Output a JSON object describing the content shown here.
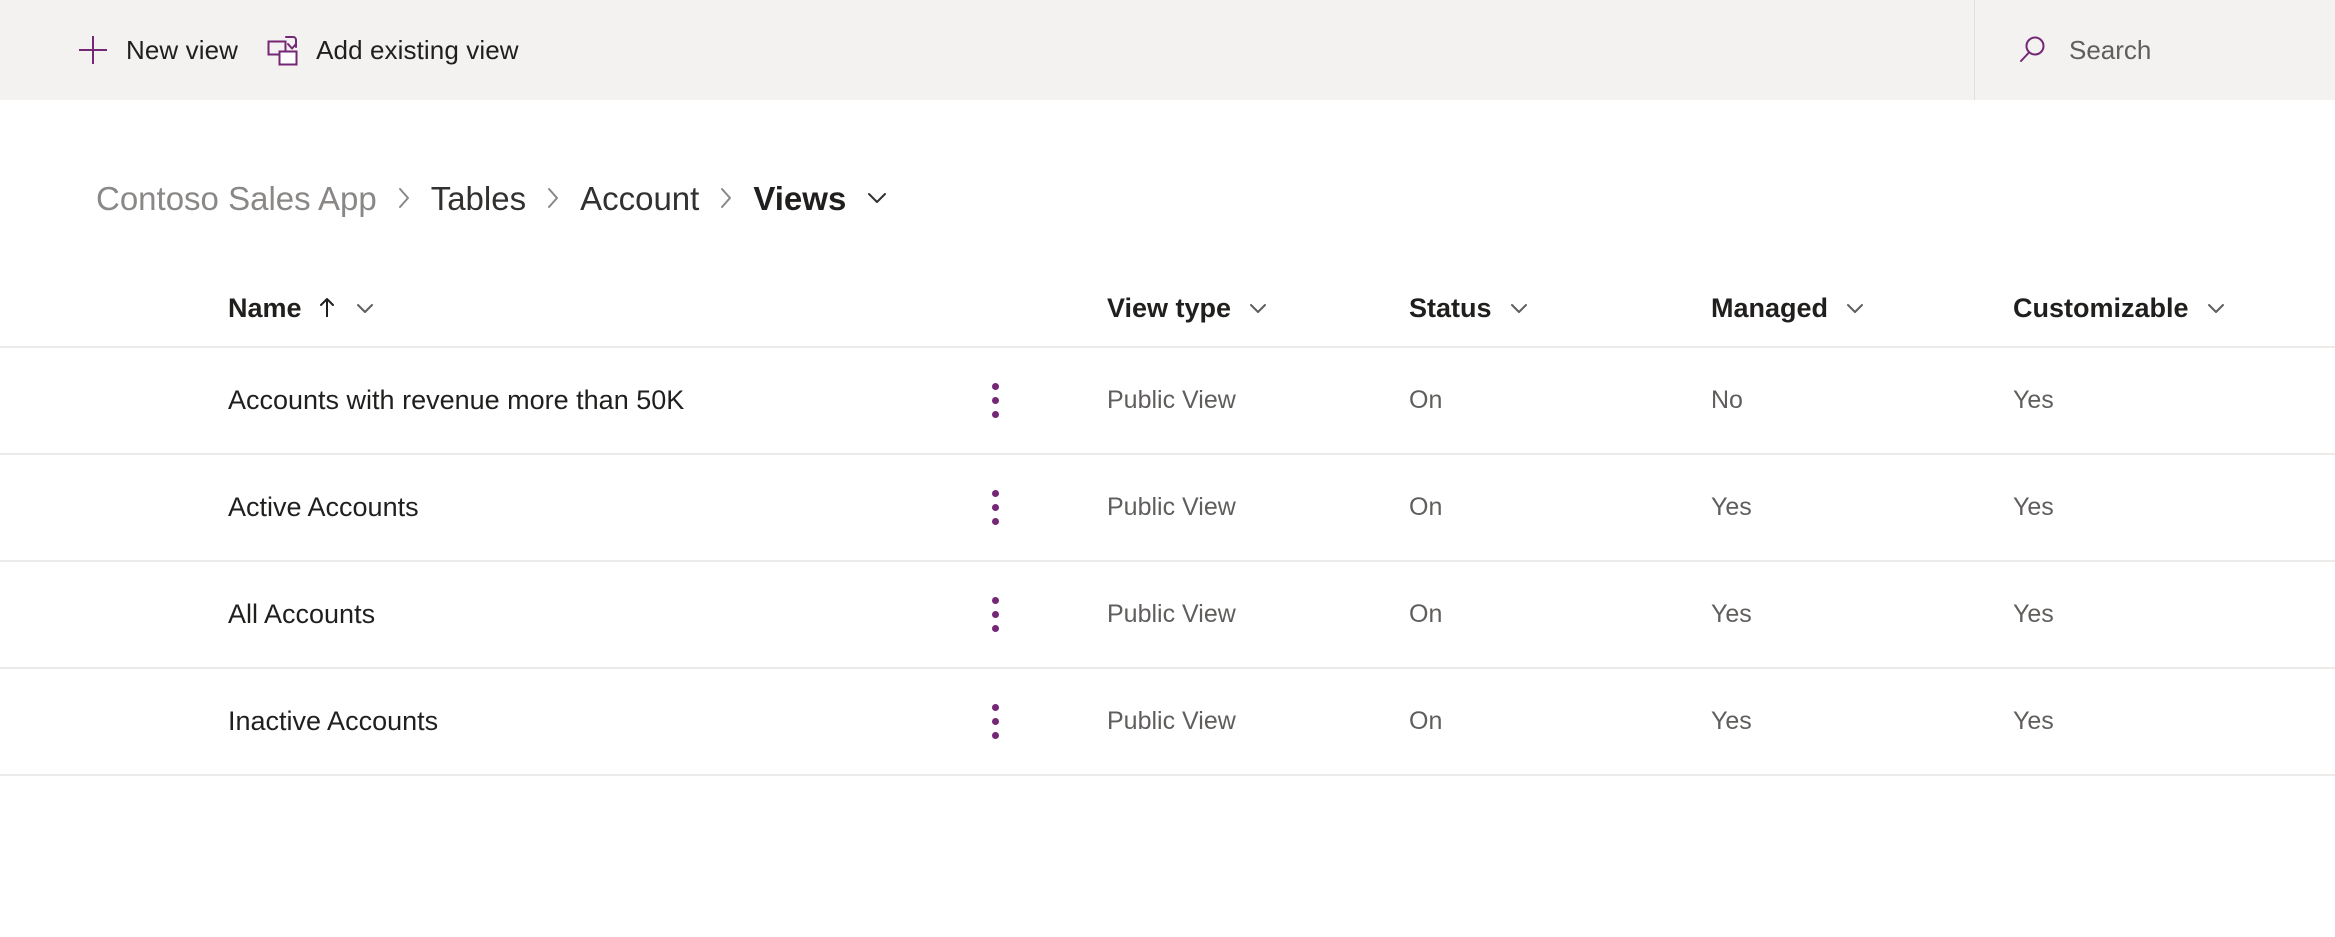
{
  "command_bar": {
    "new_view": {
      "label": "New view",
      "icon": "plus-icon"
    },
    "add_existing_view": {
      "label": "Add existing view",
      "icon": "add-existing-view-icon"
    },
    "search": {
      "placeholder": "Search",
      "value": "",
      "icon": "search-icon"
    }
  },
  "breadcrumb": {
    "items": [
      {
        "label": "Contoso Sales App",
        "current": false
      },
      {
        "label": "Tables",
        "current": false
      },
      {
        "label": "Account",
        "current": false
      },
      {
        "label": "Views",
        "current": true
      }
    ],
    "separator": "›",
    "caret": "chevron-down-icon"
  },
  "table": {
    "columns": [
      {
        "key": "name",
        "label": "Name",
        "sorted": "ascending",
        "sort_glyph": "↑"
      },
      {
        "key": "view_type",
        "label": "View type"
      },
      {
        "key": "status",
        "label": "Status"
      },
      {
        "key": "managed",
        "label": "Managed"
      },
      {
        "key": "customizable",
        "label": "Customizable"
      }
    ],
    "row_menu_icon": "more-vertical-icon",
    "rows": [
      {
        "name": "Accounts with revenue more than 50K",
        "view_type": "Public View",
        "status": "On",
        "managed": "No",
        "customizable": "Yes"
      },
      {
        "name": "Active Accounts",
        "view_type": "Public View",
        "status": "On",
        "managed": "Yes",
        "customizable": "Yes"
      },
      {
        "name": "All Accounts",
        "view_type": "Public View",
        "status": "On",
        "managed": "Yes",
        "customizable": "Yes"
      },
      {
        "name": "Inactive Accounts",
        "view_type": "Public View",
        "status": "On",
        "managed": "Yes",
        "customizable": "Yes"
      }
    ]
  },
  "colors": {
    "accent": "#742774",
    "command_bar_bg": "#f3f2f1",
    "page_bg": "#ffffff",
    "row_divider": "#edebe9",
    "text_primary": "#201f1e",
    "text_secondary": "#605e5c",
    "text_muted": "#8a8886"
  }
}
